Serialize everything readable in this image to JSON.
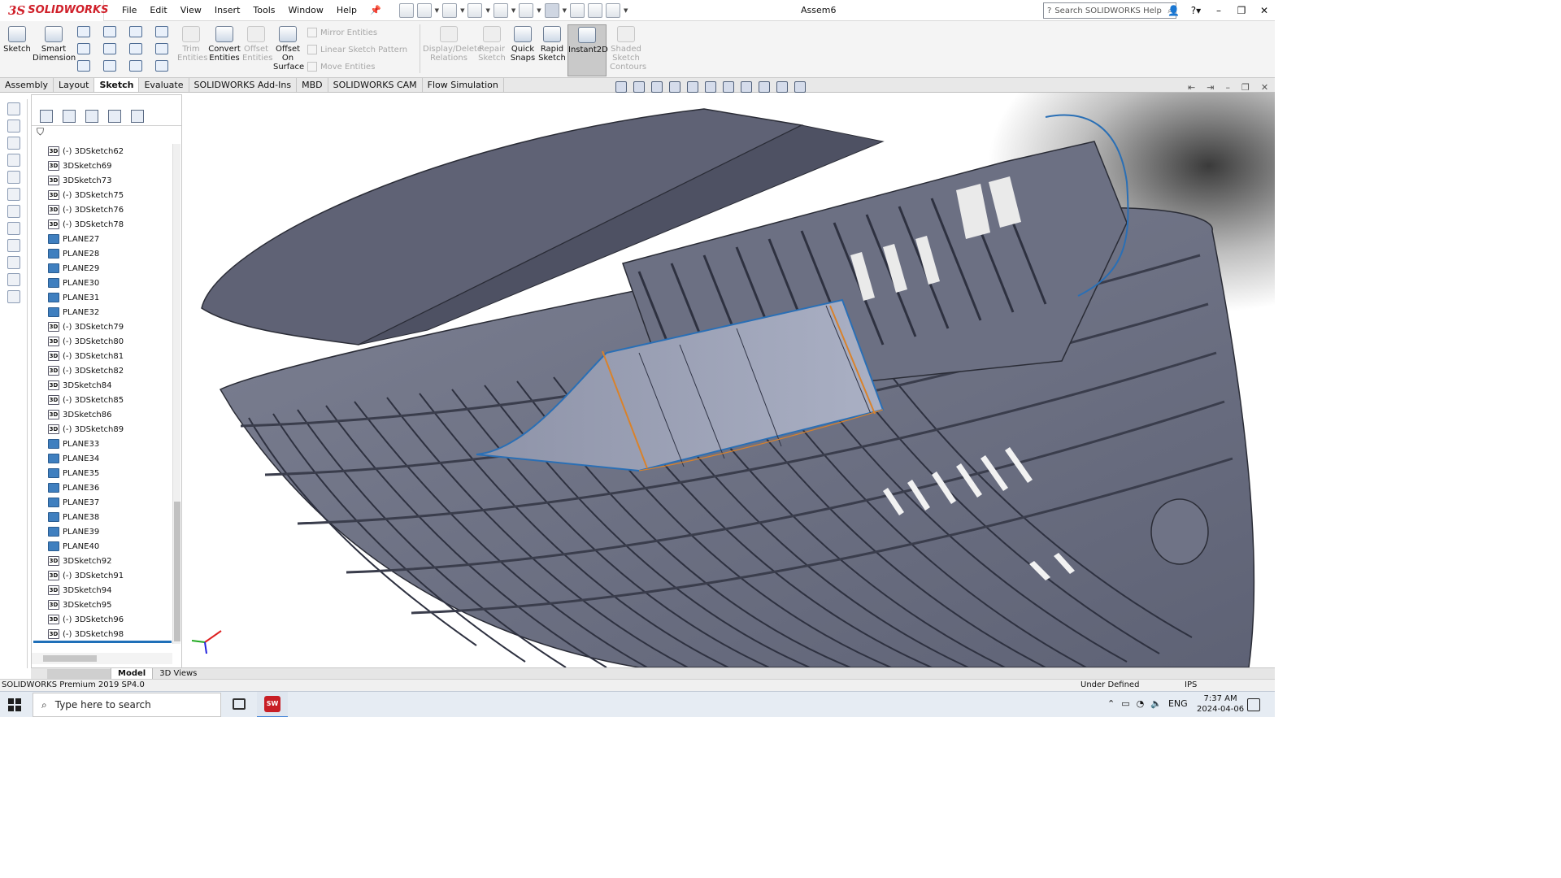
{
  "app": {
    "brand": "SOLIDWORKS",
    "document_title": "Assem6",
    "menus": [
      "File",
      "Edit",
      "View",
      "Insert",
      "Tools",
      "Window",
      "Help"
    ],
    "search_placeholder": "Search SOLIDWORKS Help"
  },
  "commands": {
    "sketch": "Sketch",
    "smart_dimension": [
      "Smart",
      "Dimension"
    ],
    "trim": [
      "Trim",
      "Entities"
    ],
    "convert": [
      "Convert",
      "Entities"
    ],
    "offset": [
      "Offset",
      "Entities"
    ],
    "offset_surface": [
      "Offset",
      "On",
      "Surface"
    ],
    "mirror": "Mirror Entities",
    "linear_pattern": "Linear Sketch Pattern",
    "move": "Move Entities",
    "display_delete": [
      "Display/Delete",
      "Relations"
    ],
    "repair": [
      "Repair",
      "Sketch"
    ],
    "quick_snaps": [
      "Quick",
      "Snaps"
    ],
    "rapid_sketch": [
      "Rapid",
      "Sketch"
    ],
    "instant2d": "Instant2D",
    "shaded": [
      "Shaded",
      "Sketch",
      "Contours"
    ]
  },
  "tabs": [
    "Assembly",
    "Layout",
    "Sketch",
    "Evaluate",
    "SOLIDWORKS Add-Ins",
    "MBD",
    "SOLIDWORKS CAM",
    "Flow Simulation"
  ],
  "active_tab": "Sketch",
  "tree": [
    {
      "label": "(-) 3DSketch62",
      "kind": "sketch"
    },
    {
      "label": "3DSketch69",
      "kind": "sketch"
    },
    {
      "label": "3DSketch73",
      "kind": "sketch"
    },
    {
      "label": "(-) 3DSketch75",
      "kind": "sketch"
    },
    {
      "label": "(-) 3DSketch76",
      "kind": "sketch"
    },
    {
      "label": "(-) 3DSketch78",
      "kind": "sketch"
    },
    {
      "label": "PLANE27",
      "kind": "plane"
    },
    {
      "label": "PLANE28",
      "kind": "plane"
    },
    {
      "label": "PLANE29",
      "kind": "plane"
    },
    {
      "label": "PLANE30",
      "kind": "plane"
    },
    {
      "label": "PLANE31",
      "kind": "plane"
    },
    {
      "label": "PLANE32",
      "kind": "plane"
    },
    {
      "label": "(-) 3DSketch79",
      "kind": "sketch"
    },
    {
      "label": "(-) 3DSketch80",
      "kind": "sketch"
    },
    {
      "label": "(-) 3DSketch81",
      "kind": "sketch"
    },
    {
      "label": "(-) 3DSketch82",
      "kind": "sketch"
    },
    {
      "label": "3DSketch84",
      "kind": "sketch"
    },
    {
      "label": "(-) 3DSketch85",
      "kind": "sketch"
    },
    {
      "label": "3DSketch86",
      "kind": "sketch"
    },
    {
      "label": "(-) 3DSketch89",
      "kind": "sketch"
    },
    {
      "label": "PLANE33",
      "kind": "plane"
    },
    {
      "label": "PLANE34",
      "kind": "plane"
    },
    {
      "label": "PLANE35",
      "kind": "plane"
    },
    {
      "label": "PLANE36",
      "kind": "plane"
    },
    {
      "label": "PLANE37",
      "kind": "plane"
    },
    {
      "label": "PLANE38",
      "kind": "plane"
    },
    {
      "label": "PLANE39",
      "kind": "plane"
    },
    {
      "label": "PLANE40",
      "kind": "plane"
    },
    {
      "label": "3DSketch92",
      "kind": "sketch"
    },
    {
      "label": "(-) 3DSketch91",
      "kind": "sketch"
    },
    {
      "label": "3DSketch94",
      "kind": "sketch"
    },
    {
      "label": "3DSketch95",
      "kind": "sketch"
    },
    {
      "label": "(-) 3DSketch96",
      "kind": "sketch"
    },
    {
      "label": "(-) 3DSketch98",
      "kind": "sketch"
    }
  ],
  "model_tabs": [
    "Model",
    "3D Views"
  ],
  "status": {
    "left": "SOLIDWORKS Premium 2019 SP4.0",
    "sketch_state": "Under Defined",
    "units": "IPS"
  },
  "taskbar": {
    "search_placeholder": "Type here to search",
    "lang": "ENG",
    "time": "7:37 AM",
    "date": "2024-04-06",
    "sw_badge": "SW"
  },
  "colors": {
    "brand_red": "#d0202a",
    "hull": "#7b7f92",
    "hull_dark": "#5d6173",
    "selection_blue": "#2a6fb5",
    "accent_orange": "#d9822b"
  }
}
